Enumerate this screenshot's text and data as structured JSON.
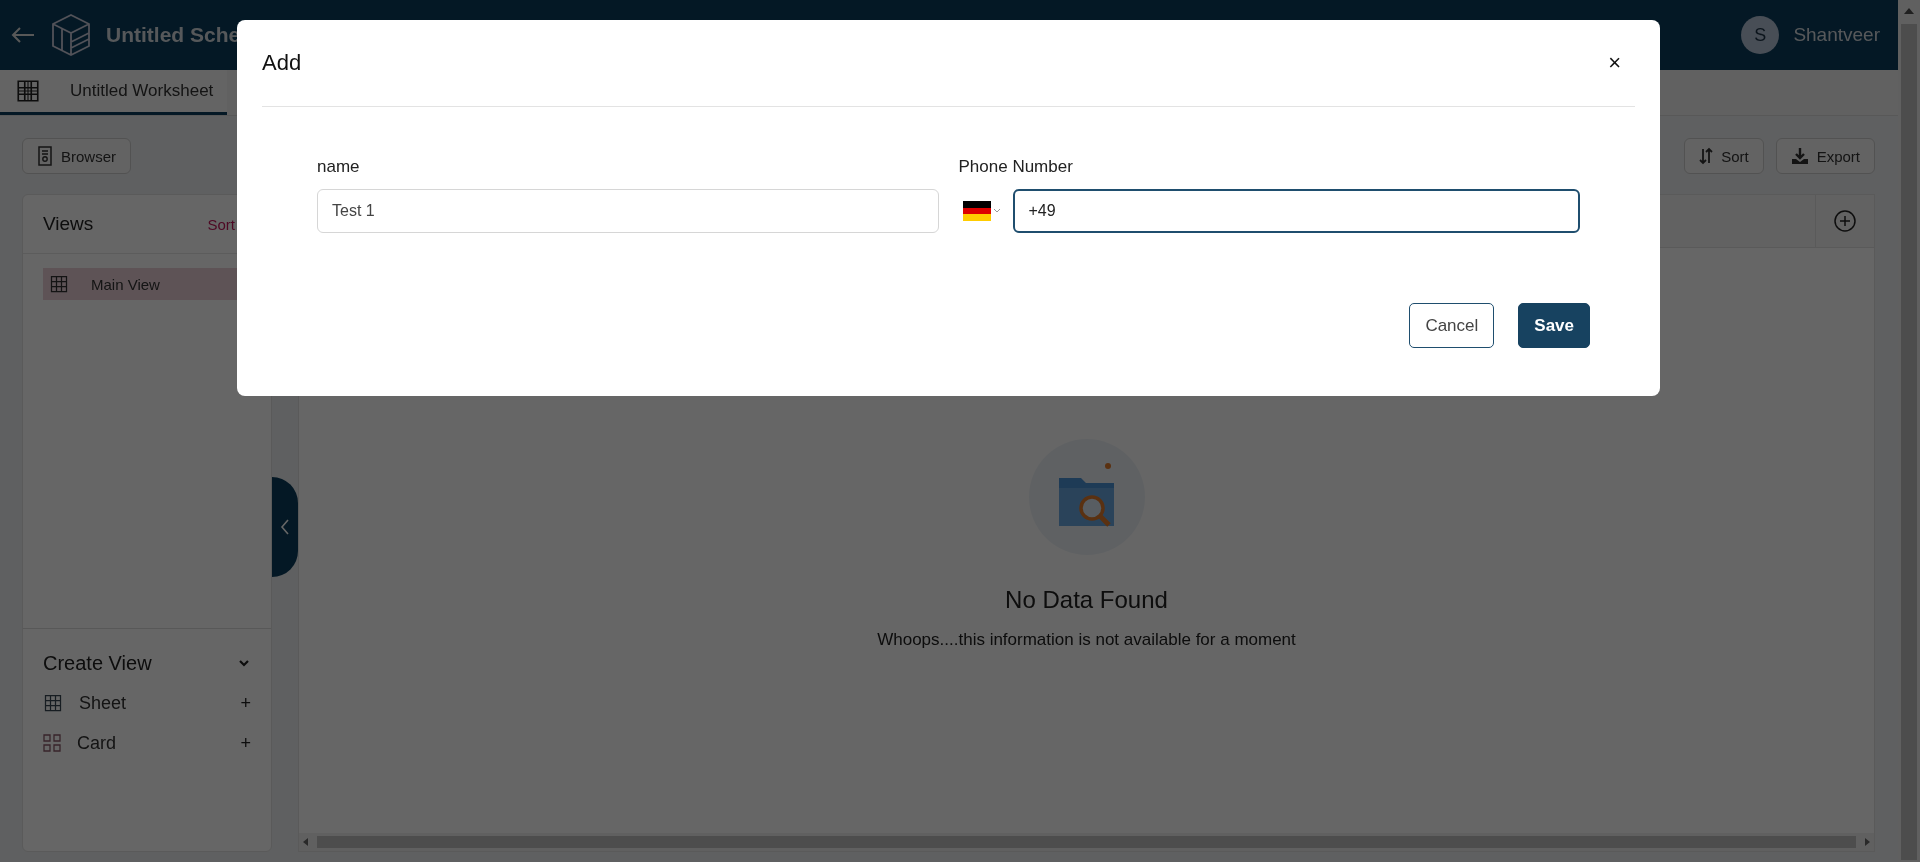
{
  "header": {
    "title": "Untitled Sche",
    "user": {
      "initial": "S",
      "name": "Shantveer"
    }
  },
  "worksheet_tabs": [
    {
      "label": "Untitled Worksheet",
      "selected": true
    }
  ],
  "toolbar": {
    "browser_button": "Browser",
    "sort_button": "Sort",
    "export_button": "Export"
  },
  "views_panel": {
    "title": "Views",
    "sort_link": "Sort",
    "views": [
      {
        "label": "Main View",
        "selected": true
      }
    ],
    "create_view": {
      "title": "Create View",
      "expanded": true,
      "items": [
        {
          "label": "Sheet",
          "kind": "sheet",
          "action": "+"
        },
        {
          "label": "Card",
          "kind": "card",
          "action": "+"
        }
      ]
    }
  },
  "empty_state": {
    "title": "No Data Found",
    "message": "Whoops....this information is not available for a moment"
  },
  "dialog": {
    "title": "Add",
    "close": "×",
    "fields": [
      {
        "label": "name",
        "kind": "text",
        "value": "Test 1",
        "focused": false
      },
      {
        "label": "Phone Number",
        "kind": "phone",
        "value": "+49",
        "focused": true
      }
    ],
    "buttons": [
      {
        "label": "Cancel",
        "kind": "secondary"
      },
      {
        "label": "Save",
        "kind": "primary"
      }
    ]
  }
}
